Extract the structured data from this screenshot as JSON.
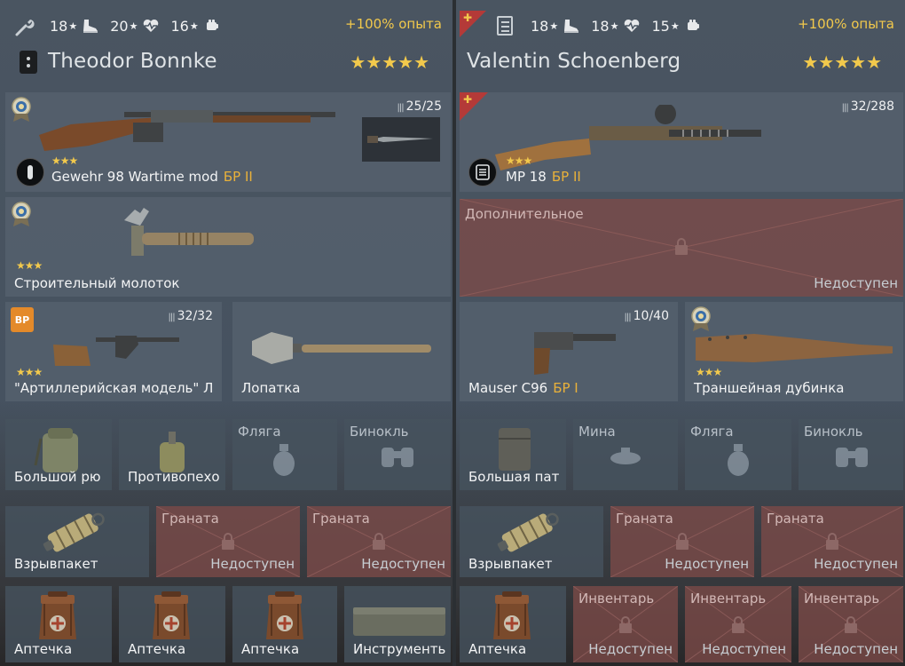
{
  "left": {
    "stats": [
      {
        "value": "18",
        "icon": "boot-icon"
      },
      {
        "value": "20",
        "icon": "heart-pulse-icon"
      },
      {
        "value": "16",
        "icon": "fist-icon"
      }
    ],
    "xp_bonus": "+100% опыта",
    "name": "Theodor Bonnke",
    "rank_stars": "★★★★★",
    "primary": {
      "name": "Gewehr 98 Wartime mod",
      "br": "БР II",
      "ammo": "25/25",
      "stars": "★★★"
    },
    "melee": {
      "name": "Строительный молоток",
      "stars": "★★★"
    },
    "secondary_left": {
      "name": "\"Артиллерийская модель\" Л",
      "ammo": "32/32",
      "stars": "★★★"
    },
    "secondary_right": {
      "name": "Лопатка"
    },
    "row4": [
      {
        "label": "Большой рю",
        "locked": false,
        "icon": "backpack-icon"
      },
      {
        "label": "Противопехо",
        "locked": false,
        "icon": "mine-icon"
      },
      {
        "label": "Фляга",
        "locked": false,
        "empty": true,
        "icon": "flask-icon"
      },
      {
        "label": "Бинокль",
        "locked": false,
        "empty": true,
        "icon": "binoculars-icon"
      }
    ],
    "row5": [
      {
        "label": "Взрывпакет",
        "locked": false
      },
      {
        "label": "Граната",
        "locked": true,
        "status": "Недоступен"
      },
      {
        "label": "Граната",
        "locked": true,
        "status": "Недоступен"
      }
    ],
    "row6": [
      {
        "label": "Аптечка"
      },
      {
        "label": "Аптечка"
      },
      {
        "label": "Аптечка"
      },
      {
        "label": "Инструменть"
      }
    ]
  },
  "right": {
    "stats": [
      {
        "value": "18",
        "icon": "boot-icon"
      },
      {
        "value": "18",
        "icon": "heart-pulse-icon"
      },
      {
        "value": "15",
        "icon": "fist-icon"
      }
    ],
    "xp_bonus": "+100% опыта",
    "name": "Valentin Schoenberg",
    "rank_stars": "★★★★★",
    "primary": {
      "name": "MP 18",
      "br": "БР II",
      "ammo": "32/288",
      "stars": "★★★"
    },
    "extra": {
      "title": "Дополнительное",
      "status": "Недоступен"
    },
    "secondary_left": {
      "name": "Mauser C96",
      "br": "БР I",
      "ammo": "10/40"
    },
    "secondary_right": {
      "name": "Траншейная дубинка",
      "stars": "★★★"
    },
    "row4": [
      {
        "label": "Большая пат",
        "icon": "pouch-icon"
      },
      {
        "label": "Мина",
        "empty": true,
        "icon": "mine-icon"
      },
      {
        "label": "Фляга",
        "empty": true,
        "icon": "flask-icon"
      },
      {
        "label": "Бинокль",
        "empty": true,
        "icon": "binoculars-icon"
      }
    ],
    "row5": [
      {
        "label": "Взрывпакет",
        "locked": false
      },
      {
        "label": "Граната",
        "locked": true,
        "status": "Недоступен"
      },
      {
        "label": "Граната",
        "locked": true,
        "status": "Недоступен"
      }
    ],
    "row6": [
      {
        "label": "Аптечка",
        "locked": false
      },
      {
        "label": "Инвентарь",
        "locked": true,
        "status": "Недоступен"
      },
      {
        "label": "Инвентарь",
        "locked": true,
        "status": "Недоступен"
      },
      {
        "label": "Инвентарь",
        "locked": true,
        "status": "Недоступен"
      }
    ]
  },
  "colors": {
    "accent_gold": "#f2c94c",
    "br_orange": "#e9b13a",
    "locked_red": "#7c4a48",
    "slot_grey": "#56626e"
  }
}
